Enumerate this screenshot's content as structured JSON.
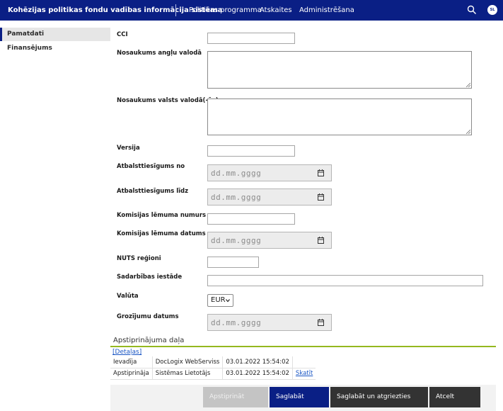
{
  "header": {
    "app_title": "Kohēzijas politikas fondu vadības informācija sistēma",
    "nav": [
      "Politikas programma",
      "Atskaites",
      "Administrēšana"
    ],
    "avatar_initials": "SL",
    "search_icon": "search-icon"
  },
  "sidebar": {
    "items": [
      {
        "label": "Pamatdati",
        "active": true
      },
      {
        "label": "Finansējums",
        "active": false
      }
    ]
  },
  "form": {
    "cci_label": "CCI",
    "name_en_label": "Nosaukums angļu valodā",
    "name_national_label": "Nosaukums valsts valodā(-ās)",
    "version_label": "Versija",
    "eligible_from_label": "Atbalsttiesīgums no",
    "eligible_to_label": "Atbalsttiesīgums līdz",
    "decision_number_label": "Komisijas lēmuma numurs",
    "decision_date_label": "Komisijas lēmuma datums",
    "nuts_label": "NUTS reģioni",
    "cooperation_label": "Sadarbības iestāde",
    "currency_label": "Valūta",
    "currency_value": "EUR",
    "amendment_date_label": "Grozījumu datums",
    "date_placeholder": "dd.mm.gggg"
  },
  "approval": {
    "title": "Apstiprinājuma daļa",
    "details_link": "[Detaļas]",
    "rows": [
      {
        "role": "Ievadīja",
        "user": "DocLogix WebServiss",
        "datetime": "03.01.2022 15:54:02",
        "link": ""
      },
      {
        "role": "Apstiprināja",
        "user": "Sistēmas Lietotājs",
        "datetime": "03.01.2022 15:54:02",
        "link": "Skatīt"
      }
    ]
  },
  "buttons": {
    "approve": "Apstiprināt",
    "save": "Saglabāt",
    "save_return": "Saglabāt un atgriezties",
    "cancel": "Atcelt"
  },
  "colors": {
    "header_bg": "#0a1f85",
    "accent_line": "#94b81f",
    "link": "#1a56c4"
  }
}
